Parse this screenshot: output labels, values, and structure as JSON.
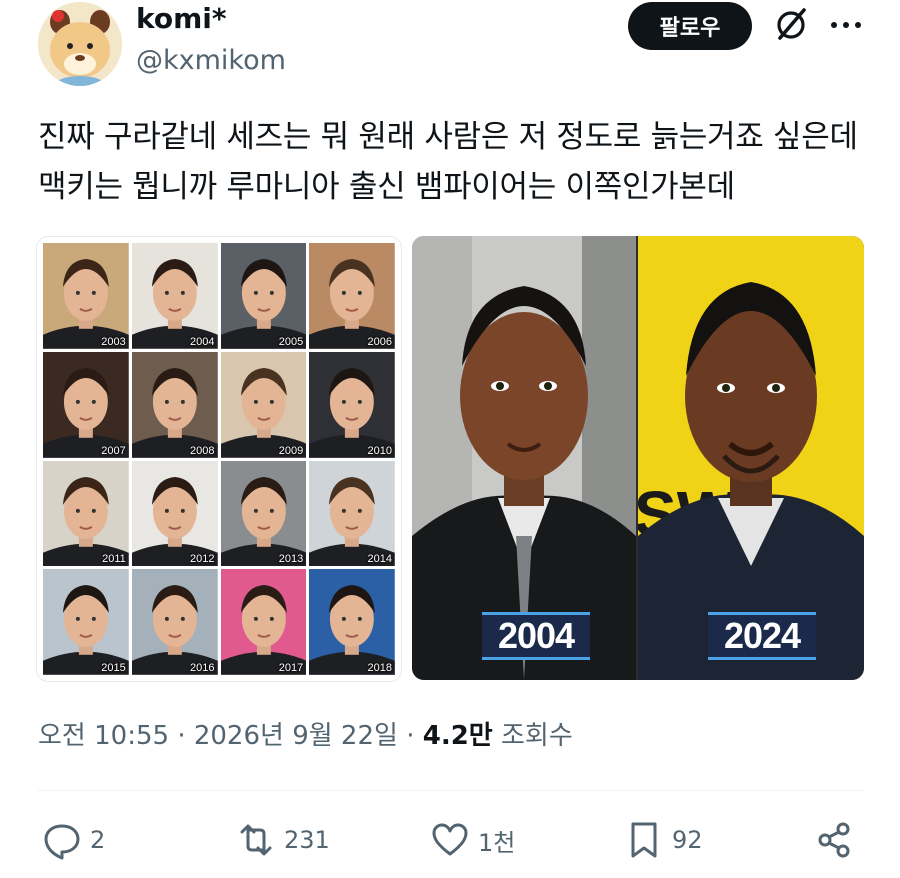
{
  "user": {
    "display_name": "komi*",
    "handle": "@kxmikom",
    "avatar_icon": "avatar-animal-icon"
  },
  "header": {
    "follow_label": "팔로우",
    "grok_icon": "grok-icon",
    "more_icon": "more-icon"
  },
  "tweet": {
    "text": "진짜 구라같네 세즈는 뭐 원래 사람은 저 정도로 늙는거죠 싶은데 맥키는 뭡니까 루마니아 출신 뱀파이어는 이쪽인가본데"
  },
  "media": {
    "left_grid_years": [
      "2003",
      "2004",
      "2005",
      "2006",
      "2007",
      "2008",
      "2009",
      "2010",
      "2011",
      "2012",
      "2013",
      "2014",
      "2015",
      "2016",
      "2017",
      "2018"
    ],
    "right_years": [
      "2004",
      "2024"
    ],
    "accent_color": "#4aa3e8"
  },
  "meta": {
    "time": "오전 10:55",
    "sep1": "·",
    "date": "2026년 9월 22일",
    "sep2": "·",
    "views_count": "4.2만",
    "views_label": "조회수"
  },
  "actions": {
    "reply_count": "2",
    "retweet_count": "231",
    "like_count": "1천",
    "bookmark_count": "92"
  }
}
